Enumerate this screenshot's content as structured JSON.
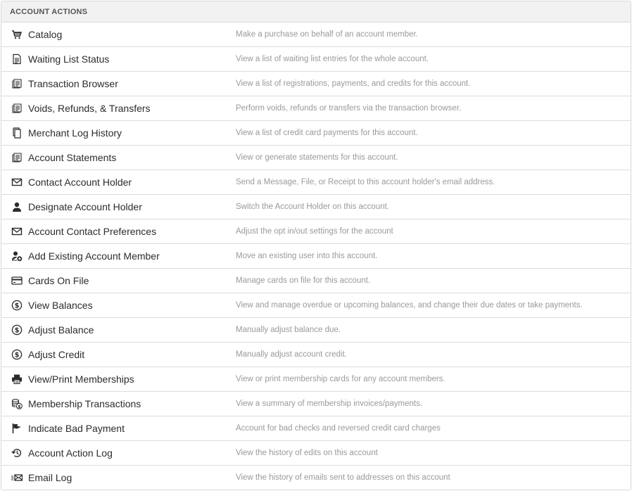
{
  "header": {
    "title": "ACCOUNT ACTIONS"
  },
  "actions": [
    {
      "label": "Catalog",
      "description": "Make a purchase on behalf of an account member.",
      "icon": "cart-icon"
    },
    {
      "label": "Waiting List Status",
      "description": "View a list of waiting list entries for the whole account.",
      "icon": "document-icon"
    },
    {
      "label": "Transaction Browser",
      "description": "View a list of registrations, payments, and credits for this account.",
      "icon": "receipts-icon"
    },
    {
      "label": "Voids, Refunds, & Transfers",
      "description": "Perform voids, refunds or transfers via the transaction browser.",
      "icon": "receipts-icon"
    },
    {
      "label": "Merchant Log History",
      "description": "View a list of credit card payments for this account.",
      "icon": "copy-icon"
    },
    {
      "label": "Account Statements",
      "description": "View or generate statements for this account.",
      "icon": "receipts-icon"
    },
    {
      "label": "Contact Account Holder",
      "description": "Send a Message, File, or Receipt to this account holder's email address.",
      "icon": "envelope-icon"
    },
    {
      "label": "Designate Account Holder",
      "description": "Switch the Account Holder on this account.",
      "icon": "user-icon"
    },
    {
      "label": "Account Contact Preferences",
      "description": "Adjust the opt in/out settings for the account",
      "icon": "envelope-icon"
    },
    {
      "label": "Add Existing Account Member",
      "description": "Move an existing user into this account.",
      "icon": "user-add-icon"
    },
    {
      "label": "Cards On File",
      "description": "Manage cards on file for this account.",
      "icon": "credit-card-icon"
    },
    {
      "label": "View Balances",
      "description": "View and manage overdue or upcoming balances, and change their due dates or take payments.",
      "icon": "dollar-circle-icon"
    },
    {
      "label": "Adjust Balance",
      "description": "Manually adjust balance due.",
      "icon": "dollar-circle-icon"
    },
    {
      "label": "Adjust Credit",
      "description": "Manually adjust account credit.",
      "icon": "dollar-circle-icon"
    },
    {
      "label": "View/Print Memberships",
      "description": "View or print membership cards for any account members.",
      "icon": "printer-icon"
    },
    {
      "label": "Membership Transactions",
      "description": "View a summary of membership invoices/payments.",
      "icon": "coins-icon"
    },
    {
      "label": "Indicate Bad Payment",
      "description": "Account for bad checks and reversed credit card charges",
      "icon": "flag-icon"
    },
    {
      "label": "Account Action Log",
      "description": "View the history of edits on this account",
      "icon": "history-icon"
    },
    {
      "label": "Email Log",
      "description": "View the history of emails sent to addresses on this account",
      "icon": "email-send-icon"
    }
  ]
}
